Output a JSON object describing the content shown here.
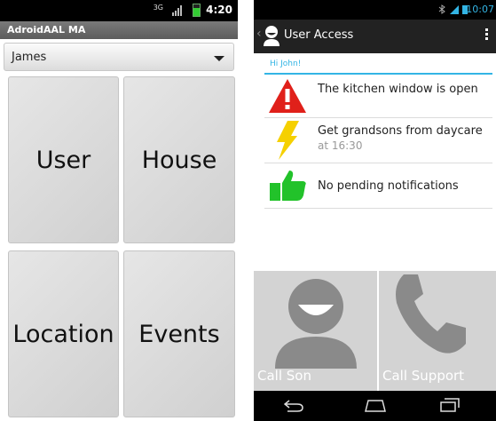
{
  "left": {
    "status": {
      "time": "4:20",
      "net_label": "3G"
    },
    "title": "AdroidAAL MA",
    "user_select": {
      "value": "James"
    },
    "tiles": [
      {
        "label": "User"
      },
      {
        "label": "House"
      },
      {
        "label": "Location"
      },
      {
        "label": "Events"
      }
    ]
  },
  "right": {
    "status": {
      "time": "10:07"
    },
    "actionbar": {
      "title": "User Access"
    },
    "greeting": "Hi John!",
    "notifications": [
      {
        "text": "The kitchen window is open",
        "sub": "",
        "icon": "warning-icon"
      },
      {
        "text": "Get grandsons from daycare",
        "sub": "at 16:30",
        "icon": "lightning-icon"
      },
      {
        "text": "No pending notifications",
        "sub": "",
        "icon": "thumbs-up-icon"
      }
    ],
    "buttons": [
      {
        "label": "Call Son",
        "icon": "person-icon"
      },
      {
        "label": "Call Support",
        "icon": "phone-icon"
      }
    ],
    "colors": {
      "accent": "#33b5e5",
      "warning": "#e0201a",
      "lightning": "#f5d000",
      "thumbs": "#22c22a"
    }
  }
}
